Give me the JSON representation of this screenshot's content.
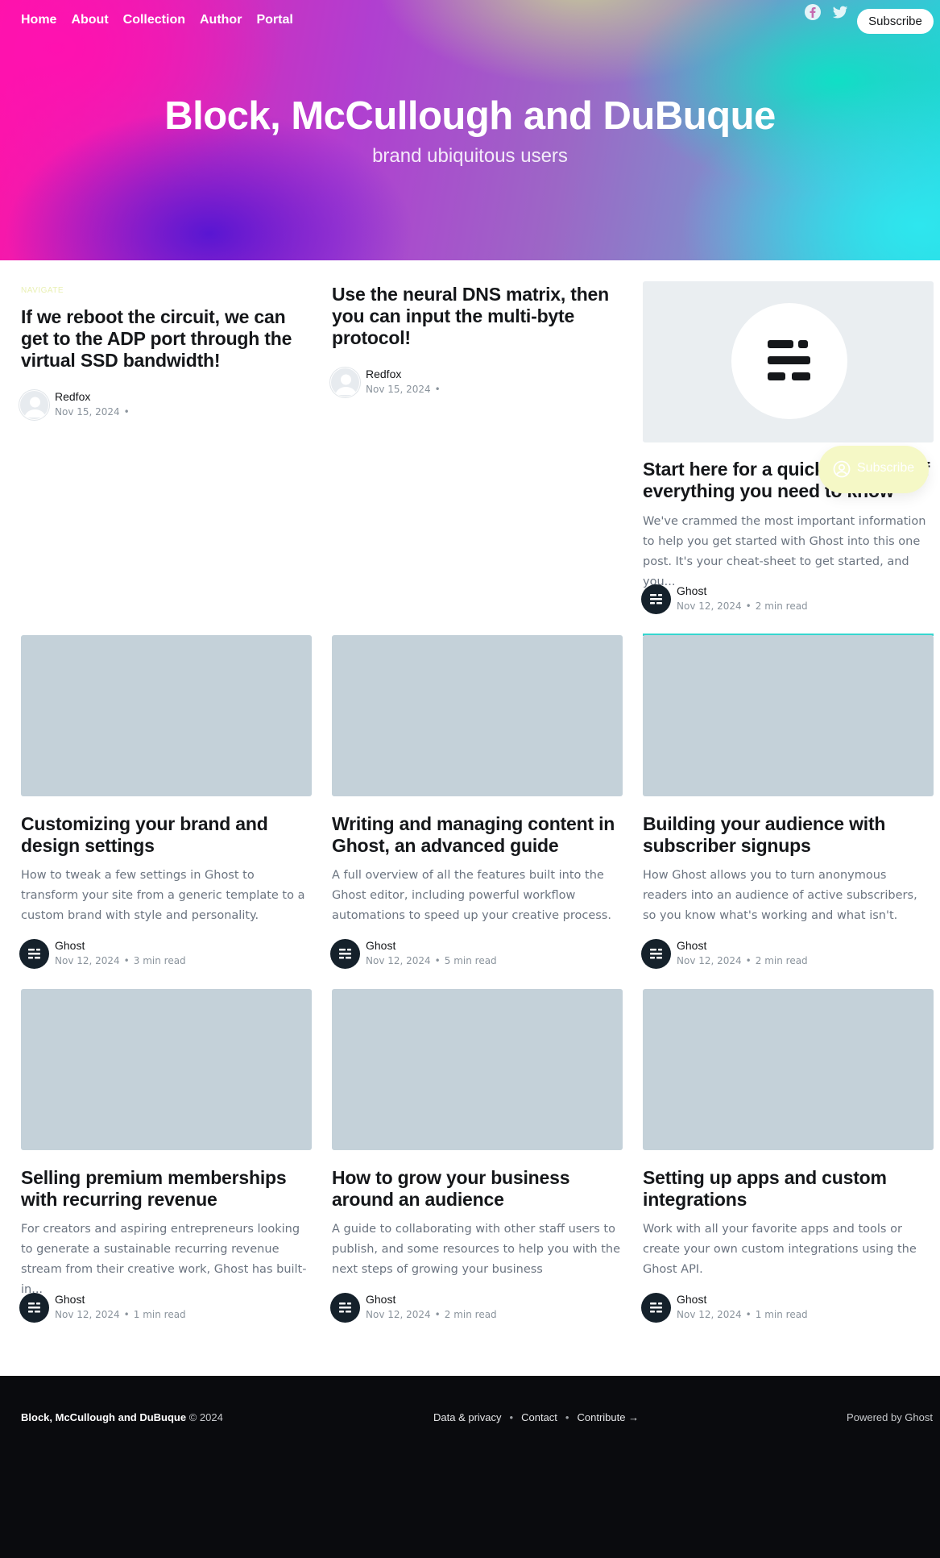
{
  "nav": {
    "items": [
      "Home",
      "About",
      "Collection",
      "Author",
      "Portal"
    ]
  },
  "header": {
    "subscribe_label": "Subscribe",
    "social_icons": [
      "facebook-icon",
      "twitter-icon"
    ]
  },
  "hero": {
    "title": "Block, McCullough and DuBuque",
    "subtitle": "brand ubiquitous users"
  },
  "nav_label": "NAVIGATE",
  "posts": [
    {
      "title": "If we reboot the circuit, we can get to the ADP port through the virtual SSD bandwidth!",
      "excerpt": "",
      "author": "Redfox",
      "date": "Nov 15, 2024",
      "read_time": ""
    },
    {
      "title": "Use the neural DNS matrix, then you can input the multi-byte protocol!",
      "excerpt": "",
      "author": "Redfox",
      "date": "Nov 15, 2024",
      "read_time": ""
    },
    {
      "title": "Start here for a quick overview of everything you need to know",
      "excerpt": "We've crammed the most important information to help you get started with Ghost into this one post. It's your cheat-sheet to get started, and you...",
      "author": "Ghost",
      "date": "Nov 12, 2024",
      "read_time": "2 min read"
    },
    {
      "title": "Customizing your brand and design settings",
      "excerpt": "How to tweak a few settings in Ghost to transform your site from a generic template to a custom brand with style and personality.",
      "author": "Ghost",
      "date": "Nov 12, 2024",
      "read_time": "3 min read"
    },
    {
      "title": "Writing and managing content in Ghost, an advanced guide",
      "excerpt": "A full overview of all the features built into the Ghost editor, including powerful workflow automations to speed up your creative process.",
      "author": "Ghost",
      "date": "Nov 12, 2024",
      "read_time": "5 min read"
    },
    {
      "title": "Building your audience with subscriber signups",
      "excerpt": "How Ghost allows you to turn anonymous readers into an audience of active subscribers, so you know what's working and what isn't.",
      "author": "Ghost",
      "date": "Nov 12, 2024",
      "read_time": "2 min read"
    },
    {
      "title": "Selling premium memberships with recurring revenue",
      "excerpt": "For creators and aspiring entrepreneurs looking to generate a sustainable recurring revenue stream from their creative work, Ghost has built-in...",
      "author": "Ghost",
      "date": "Nov 12, 2024",
      "read_time": "1 min read"
    },
    {
      "title": "How to grow your business around an audience",
      "excerpt": "A guide to collaborating with other staff users to publish, and some resources to help you with the next steps of growing your business",
      "author": "Ghost",
      "date": "Nov 12, 2024",
      "read_time": "2 min read"
    },
    {
      "title": "Setting up apps and custom integrations",
      "excerpt": "Work with all your favorite apps and tools or create your own custom integrations using the Ghost API.",
      "author": "Ghost",
      "date": "Nov 12, 2024",
      "read_time": "1 min read"
    }
  ],
  "floating_subscribe": {
    "label": "Subscribe"
  },
  "footer": {
    "site_name": "Block, McCullough and DuBuque",
    "copyright": "© 2024",
    "links": [
      "Data & privacy",
      "Contact",
      "Contribute →"
    ],
    "powered_by": "Powered by Ghost"
  },
  "colors": {
    "accent": "#36d6cf",
    "footer_bg": "#0a0b0e",
    "image_placeholder": "#c4d1d9"
  }
}
